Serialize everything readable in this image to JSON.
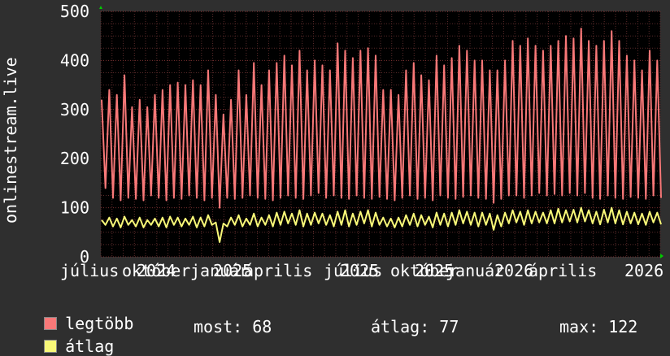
{
  "chart_data": {
    "type": "line",
    "ylabel": "onlinestream.live",
    "ylim": [
      0,
      500
    ],
    "yticks": [
      "0",
      "100",
      "200",
      "300",
      "400",
      "500"
    ],
    "xticks": [
      "július",
      "október",
      "2024",
      "január",
      "2025",
      "április",
      "július",
      "2025",
      "október",
      "2025",
      "január",
      "2026",
      "április",
      "2026"
    ],
    "grid": true,
    "background": "#000000",
    "series": [
      {
        "name": "legtöbb",
        "color": "#f87878",
        "values": [
          320,
          140,
          340,
          120,
          330,
          115,
          370,
          120,
          305,
          118,
          320,
          115,
          305,
          125,
          330,
          120,
          340,
          115,
          350,
          120,
          355,
          118,
          350,
          125,
          360,
          120,
          350,
          115,
          380,
          120,
          330,
          100,
          290,
          120,
          320,
          118,
          380,
          120,
          330,
          125,
          395,
          120,
          350,
          118,
          380,
          115,
          395,
          120,
          410,
          125,
          390,
          120,
          420,
          118,
          380,
          125,
          400,
          130,
          390,
          120,
          380,
          125,
          435,
          120,
          420,
          118,
          405,
          125,
          420,
          120,
          425,
          118,
          410,
          122,
          340,
          118,
          340,
          115,
          330,
          120,
          380,
          125,
          395,
          118,
          370,
          120,
          360,
          115,
          410,
          125,
          390,
          120,
          405,
          118,
          430,
          122,
          420,
          125,
          400,
          120,
          400,
          118,
          380,
          110,
          380,
          118,
          400,
          125,
          440,
          125,
          430,
          120,
          445,
          125,
          430,
          130,
          420,
          125,
          430,
          128,
          440,
          125,
          450,
          130,
          445,
          125,
          465,
          130,
          440,
          120,
          430,
          118,
          440,
          125,
          460,
          120,
          440,
          118,
          410,
          122,
          400,
          120,
          380,
          118,
          420,
          125,
          400,
          120
        ],
        "stat_labels": [
          "most:",
          "átlag:",
          "max:"
        ]
      },
      {
        "name": "átlag",
        "color": "#f8f878",
        "values": [
          75,
          65,
          80,
          62,
          78,
          60,
          82,
          65,
          75,
          62,
          80,
          60,
          75,
          65,
          78,
          62,
          80,
          60,
          82,
          65,
          80,
          62,
          78,
          65,
          82,
          60,
          80,
          62,
          85,
          65,
          70,
          30,
          68,
          62,
          80,
          65,
          85,
          62,
          78,
          65,
          88,
          62,
          80,
          65,
          85,
          62,
          90,
          65,
          92,
          68,
          88,
          65,
          95,
          62,
          88,
          65,
          90,
          68,
          88,
          65,
          85,
          62,
          92,
          65,
          95,
          62,
          88,
          65,
          92,
          68,
          95,
          62,
          90,
          65,
          80,
          62,
          78,
          60,
          80,
          62,
          85,
          65,
          88,
          62,
          85,
          65,
          82,
          60,
          90,
          65,
          88,
          62,
          90,
          65,
          95,
          68,
          92,
          65,
          90,
          62,
          90,
          65,
          88,
          55,
          85,
          62,
          90,
          68,
          95,
          70,
          92,
          65,
          95,
          68,
          92,
          70,
          90,
          68,
          95,
          68,
          98,
          70,
          95,
          72,
          96,
          70,
          100,
          72,
          95,
          68,
          92,
          66,
          96,
          70,
          100,
          68,
          95,
          66,
          92,
          68,
          90,
          66,
          88,
          65,
          92,
          70,
          90,
          66
        ],
        "stats": [
          "68",
          "77",
          "122"
        ]
      }
    ],
    "stats_block": {
      "most_label": "most: 68",
      "atlag_label": "átlag: 77",
      "max_label": "max: 122"
    }
  }
}
